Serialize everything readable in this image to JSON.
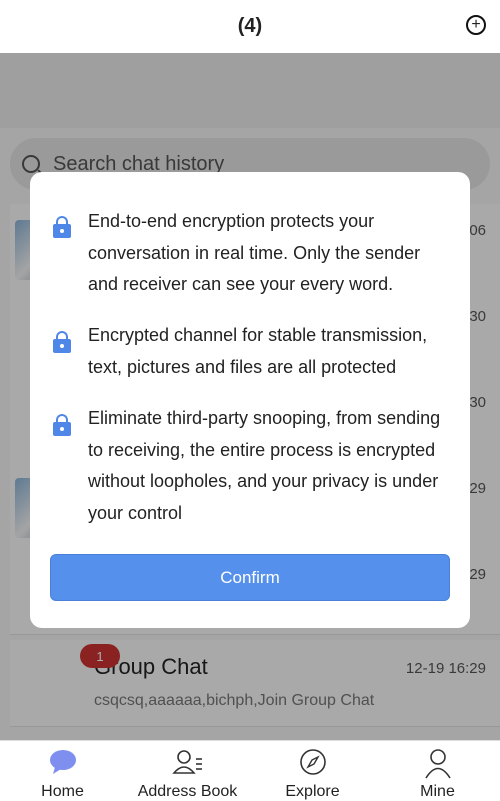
{
  "header": {
    "title": "(4)"
  },
  "search": {
    "placeholder": "Search chat history"
  },
  "chats": [
    {
      "time": "06"
    },
    {
      "time": "30"
    },
    {
      "time": "30"
    },
    {
      "time": "29"
    },
    {
      "time": "29"
    }
  ],
  "group": {
    "badge": "1",
    "title": "Group Chat",
    "subtitle": "csqcsq,aaaaaa,bichph,Join Group Chat",
    "time": "12-19 16:29"
  },
  "modal": {
    "items": [
      "End-to-end encryption protects your conversation in real time. Only the sender and receiver can see your every word.",
      "Encrypted channel for stable transmission, text, pictures and files are all protected",
      "Eliminate third-party snooping, from sending to receiving, the entire process is encrypted without loopholes, and your privacy is under your control"
    ],
    "confirm_label": "Confirm"
  },
  "tabbar": {
    "items": [
      {
        "label": "Home",
        "icon": "chat-bubble-icon"
      },
      {
        "label": "Address Book",
        "icon": "contacts-icon"
      },
      {
        "label": "Explore",
        "icon": "compass-icon"
      },
      {
        "label": "Mine",
        "icon": "person-icon"
      }
    ]
  },
  "colors": {
    "accent": "#5591ec",
    "badge": "#cc3333"
  }
}
